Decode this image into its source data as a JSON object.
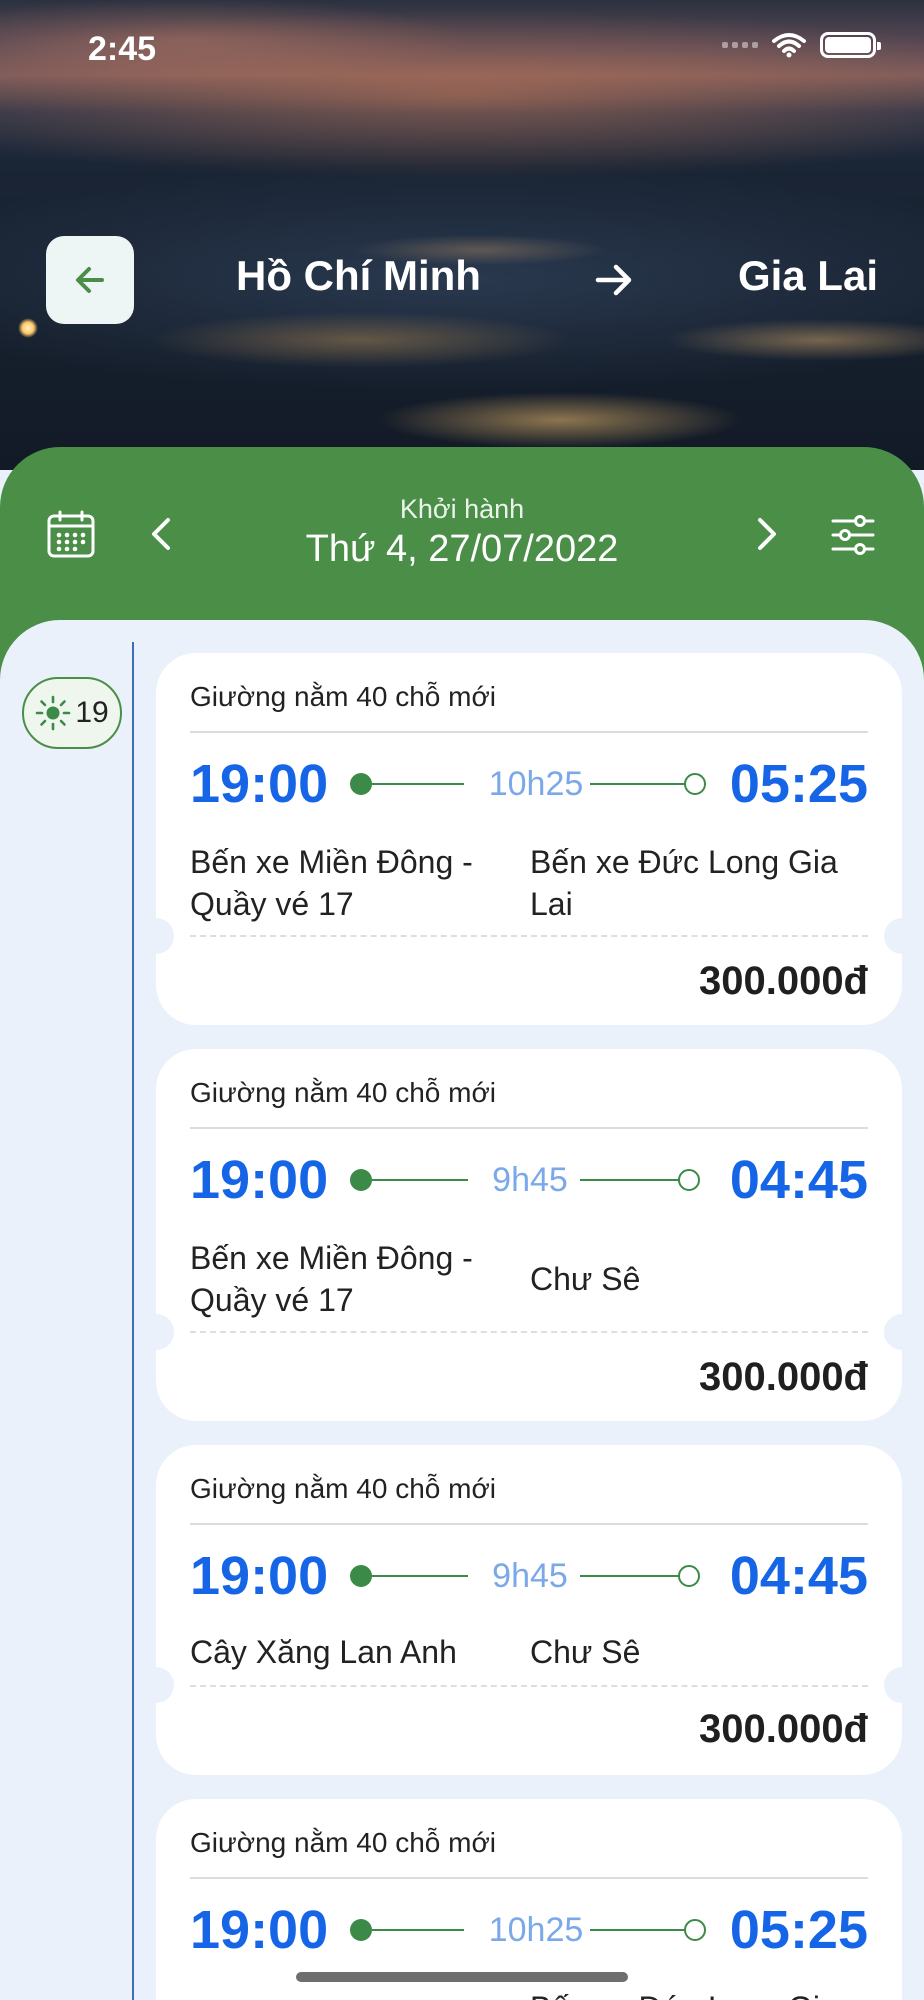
{
  "status_bar": {
    "time": "2:45"
  },
  "route": {
    "from": "Hồ Chí Minh",
    "to": "Gia Lai"
  },
  "date_bar": {
    "caption": "Khởi hành",
    "date": "Thứ 4, 27/07/2022"
  },
  "time_group": {
    "hour": "19",
    "icon": "sun-icon"
  },
  "colors": {
    "green": "#4a8e48",
    "blue": "#1565e6",
    "duration": "#7aa8e8"
  },
  "trips": [
    {
      "type": "Giường nằm 40 chỗ mới",
      "depart": "19:00",
      "duration": "10h25",
      "arrive": "05:25",
      "from": "Bến xe Miền Đông - Quầy vé 17",
      "to": "Bến xe Đức Long Gia Lai",
      "price": "300.000đ"
    },
    {
      "type": "Giường nằm 40 chỗ mới",
      "depart": "19:00",
      "duration": "9h45",
      "arrive": "04:45",
      "from": "Bến xe Miền Đông - Quầy vé 17",
      "to": "Chư Sê",
      "price": "300.000đ"
    },
    {
      "type": "Giường nằm 40 chỗ mới",
      "depart": "19:00",
      "duration": "9h45",
      "arrive": "04:45",
      "from": "Cây Xăng Lan Anh",
      "to": "Chư Sê",
      "price": "300.000đ"
    },
    {
      "type": "Giường nằm 40 chỗ mới",
      "depart": "19:00",
      "duration": "10h25",
      "arrive": "05:25",
      "from": "",
      "to": "Bến xe Đức Long Gia Lai",
      "price": ""
    }
  ]
}
